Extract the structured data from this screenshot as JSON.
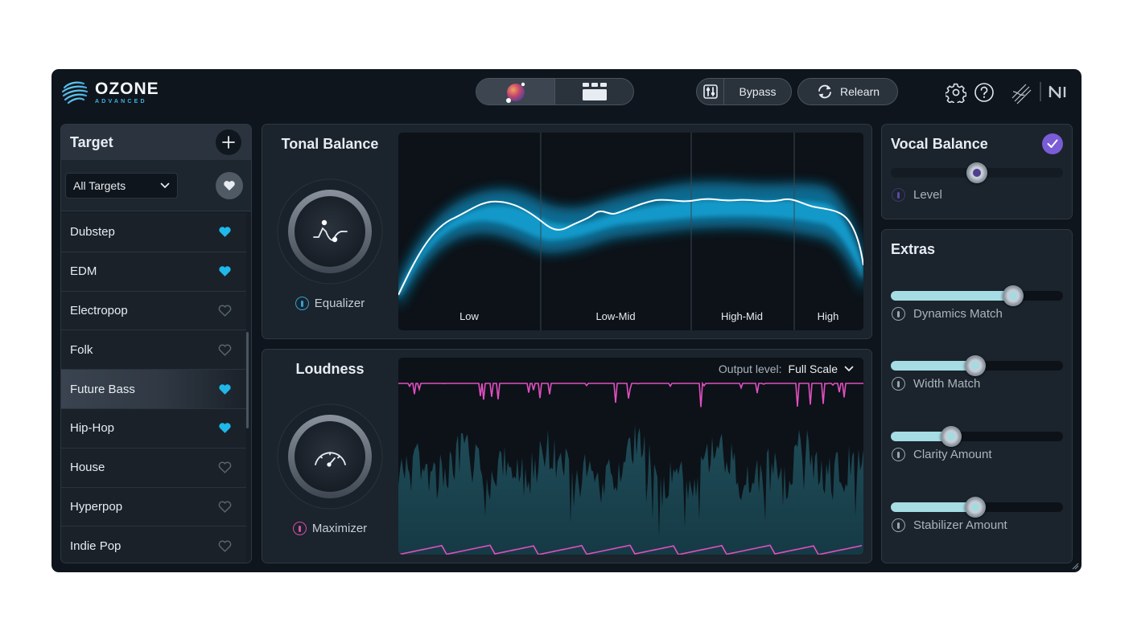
{
  "app": {
    "name": "OZONE",
    "edition": "ADVANCED",
    "brand_accent": "#3fb3e0"
  },
  "header": {
    "mode_switch": [
      {
        "icon": "orb-assistant-icon",
        "active": true
      },
      {
        "icon": "modules-grid-icon",
        "active": false
      }
    ],
    "bypass_label": "Bypass",
    "relearn_label": "Relearn",
    "icons": [
      "settings-gear-icon",
      "help-question-icon",
      "signal-chain-icon",
      "native-instruments-logo"
    ]
  },
  "target": {
    "title": "Target",
    "filter_value": "All Targets",
    "items": [
      {
        "label": "Dubstep",
        "favorite": true,
        "selected": false
      },
      {
        "label": "EDM",
        "favorite": true,
        "selected": false
      },
      {
        "label": "Electropop",
        "favorite": false,
        "selected": false
      },
      {
        "label": "Folk",
        "favorite": false,
        "selected": false
      },
      {
        "label": "Future Bass",
        "favorite": true,
        "selected": true
      },
      {
        "label": "Hip-Hop",
        "favorite": true,
        "selected": false
      },
      {
        "label": "House",
        "favorite": false,
        "selected": false
      },
      {
        "label": "Hyperpop",
        "favorite": false,
        "selected": false
      },
      {
        "label": "Indie Pop",
        "favorite": false,
        "selected": false
      }
    ]
  },
  "tonal_balance": {
    "title": "Tonal Balance",
    "module_label": "Equalizer",
    "bands": [
      "Low",
      "Low-Mid",
      "High-Mid",
      "High"
    ],
    "accent": "#1fb8e8"
  },
  "loudness": {
    "title": "Loudness",
    "module_label": "Maximizer",
    "output_level_label": "Output level:",
    "output_level_value": "Full Scale",
    "accent": "#e24fc0"
  },
  "vocal_balance": {
    "title": "Vocal Balance",
    "enabled": true,
    "level_label": "Level",
    "level": 0.5
  },
  "extras": {
    "title": "Extras",
    "controls": [
      {
        "label": "Dynamics Match",
        "value": 0.71
      },
      {
        "label": "Width Match",
        "value": 0.49
      },
      {
        "label": "Clarity Amount",
        "value": 0.35
      },
      {
        "label": "Stabilizer Amount",
        "value": 0.49
      }
    ]
  }
}
